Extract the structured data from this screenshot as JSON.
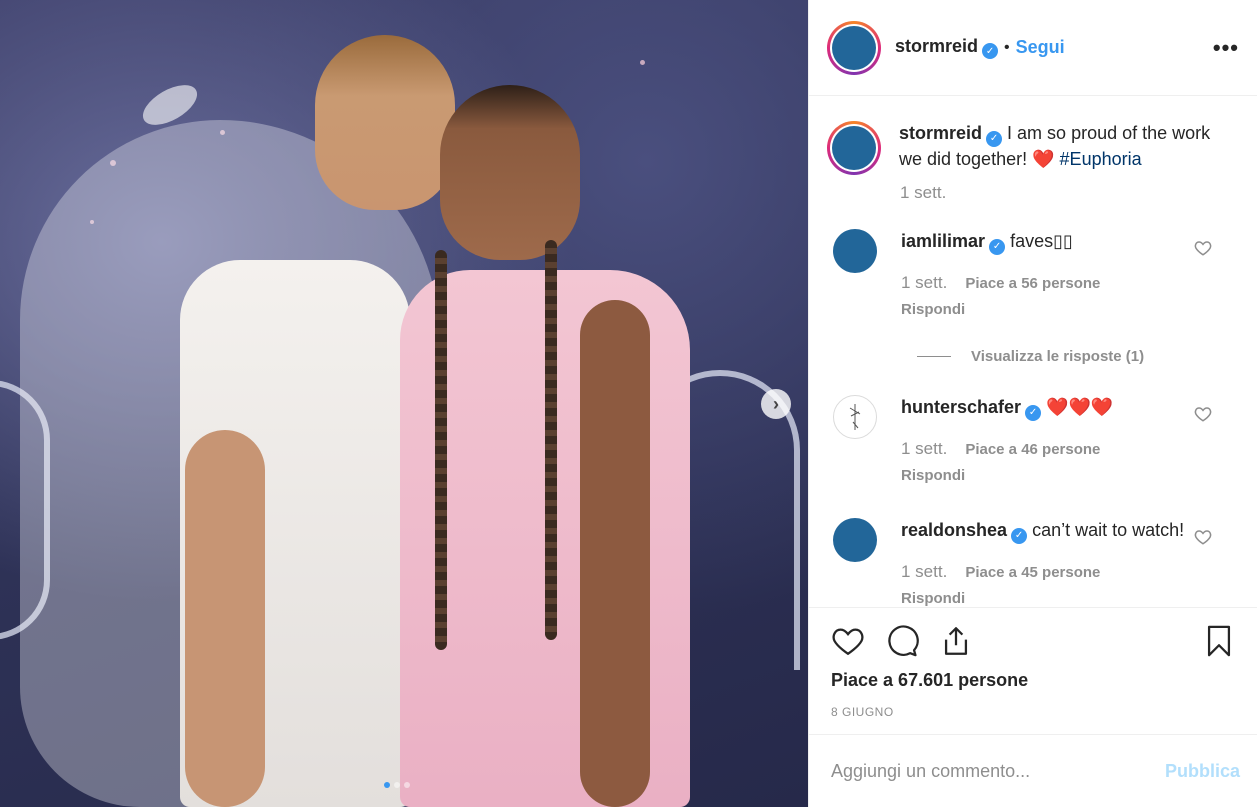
{
  "photo": {
    "alt_next": "›",
    "dots": [
      true,
      false,
      false
    ]
  },
  "header": {
    "username": "stormreid",
    "bullet": "•",
    "follow_label": "Segui",
    "more_label": "•••"
  },
  "caption": {
    "username": "stormreid",
    "text": "I am so proud of the work we did together!",
    "emoji": "❤️",
    "hashtag": "#Euphoria",
    "time": "1 sett."
  },
  "comments": [
    {
      "username": "iamlilimar",
      "text": "faves▯▯",
      "time": "1 sett.",
      "likes": "Piace a 56 persone",
      "reply": "Rispondi",
      "view_replies": "Visualizza le risposte (1)"
    },
    {
      "username": "hunterschafer",
      "text": "❤️❤️❤️",
      "time": "1 sett.",
      "likes": "Piace a 46 persone",
      "reply": "Rispondi"
    },
    {
      "username": "realdonshea",
      "text": "can’t wait to watch!",
      "time": "1 sett.",
      "likes": "Piace a 45 persone",
      "reply": "Rispondi"
    }
  ],
  "actions": {
    "likes_total": "Piace a 67.601 persone",
    "date": "8 GIUGNO"
  },
  "add_comment": {
    "placeholder": "Aggiungi un commento...",
    "publish_label": "Pubblica"
  },
  "colors": {
    "accent": "#3897f0",
    "avatar": "#226699",
    "muted": "#8e8e8e",
    "publish_disabled": "#b2dffc"
  }
}
